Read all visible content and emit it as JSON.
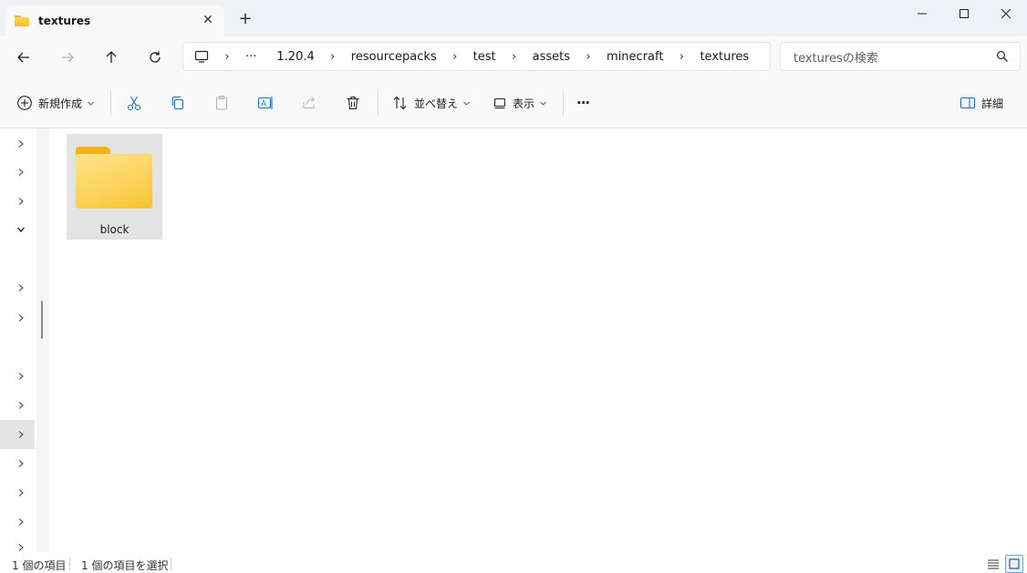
{
  "tab": {
    "title": "textures",
    "close_glyph": "✕"
  },
  "window": {
    "new_tab_glyph": "+"
  },
  "breadcrumb": {
    "overflow": "···",
    "separator": "›",
    "items": [
      "1.20.4",
      "resourcepacks",
      "test",
      "assets",
      "minecraft",
      "textures"
    ]
  },
  "search": {
    "placeholder": "texturesの検索"
  },
  "toolbar": {
    "new_label": "新規作成",
    "sort_label": "並べ替え",
    "view_label": "表示",
    "details_label": "詳細",
    "more_glyph": "···"
  },
  "content": {
    "items": [
      {
        "name": "block",
        "type": "folder"
      }
    ]
  },
  "statusbar": {
    "item_count": "1 個の項目",
    "selected_count": "1 個の項目を選択"
  }
}
